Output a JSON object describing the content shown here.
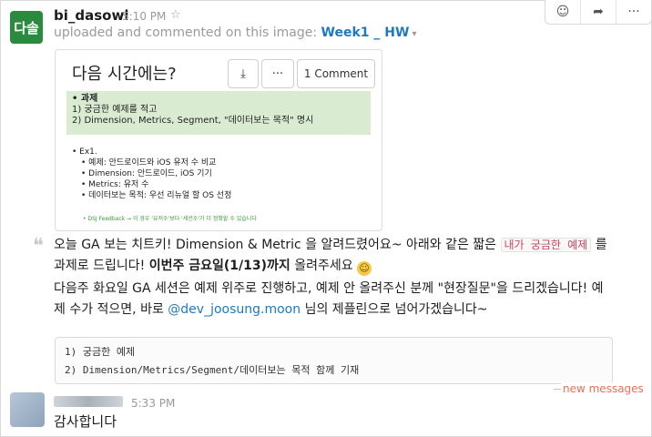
{
  "message": {
    "avatar_text": "다솔",
    "author": "bi_dasowl",
    "time": "5:10 PM",
    "star": "☆",
    "uploaded_text": "uploaded and commented on this image:",
    "file_name": "Week1 _ HW",
    "caret": "▾"
  },
  "actions": {
    "add_reaction": "☺",
    "share": "➦",
    "more": "···"
  },
  "preview": {
    "title": "다음 시간에는?",
    "download_icon": "⤓",
    "more_label": "···",
    "comment_label": "1 Comment",
    "green_lines": [
      "• 과제",
      "  1) 궁금한 예제를 적고",
      "  2) Dimension, Metrics, Segment, \"데이터보는 목적\" 명시"
    ],
    "list_head": "• Ex1.",
    "list_items": [
      "• 예제: 안드로이드와 iOS 유저 수 비교",
      "• Dimension: 안드로이드, iOS 기기",
      "• Metrics: 유저 수",
      "• 데이터보는 목적: 우선 리뉴얼 할 OS 선정"
    ],
    "feedback": "• DSJ Feedback → 이 경우 '유저수'보다 '세션수'가 더 정확할 수 있습니다"
  },
  "quote_mark": "❝",
  "comment": {
    "p1_a": "오늘 GA 보는 치트키! Dimension & Metric 을 알려드렸어요~ 아래와 같은 짧은 ",
    "p1_code": "내가 궁금한 예제",
    "p1_b": " 를 과제로 드립니다! ",
    "p1_bold": "이번주 금요일(1/13)까지",
    "p1_c": " 올려주세요 ",
    "emoji": "☺",
    "p2_a": "다음주 화요일 GA 세션은 예제 위주로 진행하고, 예제 안 올려주신 분께 \"현장질문\"을 드리겠습니다! 예제 수가 적으면, 바로 ",
    "p2_mention": "@dev_joosung.moon",
    "p2_b": " 님의 제플린으로 넘어가겠습니다~"
  },
  "codeblock": {
    "lines": [
      "1) 궁금한 예제",
      "2) Dimension/Metrics/Segment/데이터보는 목적 함께 기재"
    ]
  },
  "new_messages": "new messages",
  "reply": {
    "time": "5:33 PM",
    "text": "감사합니다"
  }
}
